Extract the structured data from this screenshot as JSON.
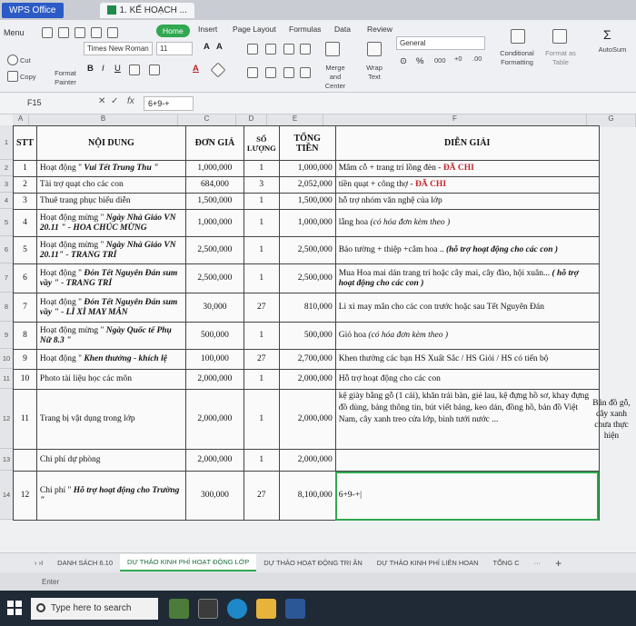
{
  "app": {
    "name": "WPS Office",
    "doc_tab": "1. KẾ HOẠCH ..."
  },
  "ribbon": {
    "menu": "Menu",
    "tabs": [
      "Home",
      "Insert",
      "Page Layout",
      "Formulas",
      "Data",
      "Review"
    ],
    "font_name": "Times New Roman",
    "font_size": "11",
    "cut": "Cut",
    "copy": "Copy",
    "format_painter": "Format Painter",
    "merge_center": "Merge and Center",
    "wrap_text": "Wrap Text",
    "number_format": "General",
    "conditional_formatting": "Conditional Formatting",
    "format_as_table": "Format as Table",
    "autosum": "AutoSum"
  },
  "formula_bar": {
    "cell": "F15",
    "fx": "fx",
    "value": "6+9-+"
  },
  "columns": [
    "A",
    "B",
    "C",
    "D",
    "E",
    "F",
    "G"
  ],
  "rows": [
    "1",
    "2",
    "3",
    "4",
    "5",
    "6",
    "7",
    "8",
    "9",
    "10",
    "11",
    "12",
    "13",
    "14",
    "15"
  ],
  "table": {
    "headers": {
      "stt": "STT",
      "noidung": "NỘI DUNG",
      "dongia": "ĐƠN GIÁ",
      "soluong": "SỐ LƯỢNG",
      "tongtien": "TỔNG TIỀN",
      "diengiai": "DIỄN GIẢI"
    },
    "rows": [
      {
        "stt": "1",
        "noidung_a": "Hoạt động \" ",
        "noidung_b": "Vui Tết Trung Thu \"",
        "dongia": "1,000,000",
        "soluong": "1",
        "tongtien": "1,000,000",
        "dg_a": "Mâm cỗ + trang trí lồng đèn - ",
        "dg_b": "ĐÃ CHI"
      },
      {
        "stt": "2",
        "noidung_a": "Tài trợ quạt cho các con",
        "dongia": "684,000",
        "soluong": "3",
        "tongtien": "2,052,000",
        "dg_a": "tiền quạt + công thợ - ",
        "dg_b": "ĐÃ CHI"
      },
      {
        "stt": "3",
        "noidung_a": "Thuê trang phục biểu diễn",
        "dongia": "1,500,000",
        "soluong": "1",
        "tongtien": "1,500,000",
        "dg_a": "hỗ trợ nhóm văn nghệ của lớp"
      },
      {
        "stt": "4",
        "noidung_a": "Hoạt động mừng \" ",
        "noidung_b": "Ngày Nhà Giáo VN 20.11 \" - HOA CHÚC MỪNG",
        "dongia": "1,000,000",
        "soluong": "1",
        "tongtien": "1,000,000",
        "dg_a": "lẵng hoa ",
        "dg_b": "(có hóa đơn kèm theo )"
      },
      {
        "stt": "5",
        "noidung_a": "Hoạt động mừng \" ",
        "noidung_b": "Ngày Nhà Giáo VN 20.11\" - TRANG TRÍ",
        "dongia": "2,500,000",
        "soluong": "1",
        "tongtien": "2,500,000",
        "dg_a": "Báo tường + thiệp +cắm hoa .. ",
        "dg_b": "(hỗ trợ hoạt động cho các con )"
      },
      {
        "stt": "6",
        "noidung_a": "Hoạt động \" ",
        "noidung_b": "Đón Tết Nguyên Đán sum vầy \" - TRANG TRÍ",
        "dongia": "2,500,000",
        "soluong": "1",
        "tongtien": "2,500,000",
        "dg_a": "Mua Hoa mai dán trang trí hoặc cây mai, cây đào, hội xuân... ",
        "dg_b": "( hỗ trợ hoạt động cho các con )"
      },
      {
        "stt": "7",
        "noidung_a": "Hoạt động \" ",
        "noidung_b": "Đón Tết Nguyên Đán sum vầy \" - LÌ XÌ MAY MẮN",
        "dongia": "30,000",
        "soluong": "27",
        "tongtien": "810,000",
        "dg_a": "Lì xì may mắn cho các con trước hoặc sau Tết Nguyên Đán"
      },
      {
        "stt": "8",
        "noidung_a": "Hoạt động mừng \" ",
        "noidung_b": "Ngày Quốc tế Phụ Nữ 8.3 \"",
        "dongia": "500,000",
        "soluong": "1",
        "tongtien": "500,000",
        "dg_a": "Giỏ hoa ",
        "dg_b": "(có hóa đơn kèm theo )"
      },
      {
        "stt": "9",
        "noidung_a": "Hoạt động \" ",
        "noidung_b": "Khen thưởng - khích lệ",
        "dongia": "100,000",
        "soluong": "27",
        "tongtien": "2,700,000",
        "dg_a": "Khen thưởng các bạn HS Xuất Sắc / HS Giỏi / HS có tiến bộ"
      },
      {
        "stt": "10",
        "noidung_a": "Photo tài liệu học các môn",
        "dongia": "2,000,000",
        "soluong": "1",
        "tongtien": "2,000,000",
        "dg_a": "Hỗ trợ hoạt động cho các con"
      },
      {
        "stt": "11",
        "noidung_a": "Trang bị vật dụng trong lớp",
        "dongia": "2,000,000",
        "soluong": "1",
        "tongtien": "2,000,000",
        "dg_a": "kệ giày bằng gỗ (1 cái), khăn trải bàn, giẻ lau, kệ đựng hồ sơ, khay đựng đồ dùng, bảng thông tin, bút viết bảng, keo dán, đồng hồ, bản đồ Việt Nam, cây xanh treo cửa lớp, bình tưới nước ..."
      },
      {
        "stt": "",
        "noidung_a": "Chi phí dự phòng",
        "dongia": "2,000,000",
        "soluong": "1",
        "tongtien": "2,000,000",
        "dg_a": ""
      },
      {
        "stt": "12",
        "noidung_a": "Chi phí \" ",
        "noidung_b": "Hỗ trợ hoạt động cho Trường \"",
        "dongia": "300,000",
        "soluong": "27",
        "tongtien": "8,100,000",
        "dg_a": "6+9-+|"
      }
    ]
  },
  "g_note": "Bản đồ gỗ, cây xanh chưa thực hiện",
  "sheet_tabs": [
    "DANH SÁCH 6.10",
    "DỰ THẢO KINH PHÍ HOẠT ĐỘNG LỚP",
    "DỰ THẢO HOẠT ĐỘNG TRI ÂN",
    "DỰ THẢO KINH PHÍ LIÊN HOAN",
    "TỔNG C"
  ],
  "status": "Enter",
  "taskbar": {
    "search_placeholder": "Type here to search"
  }
}
